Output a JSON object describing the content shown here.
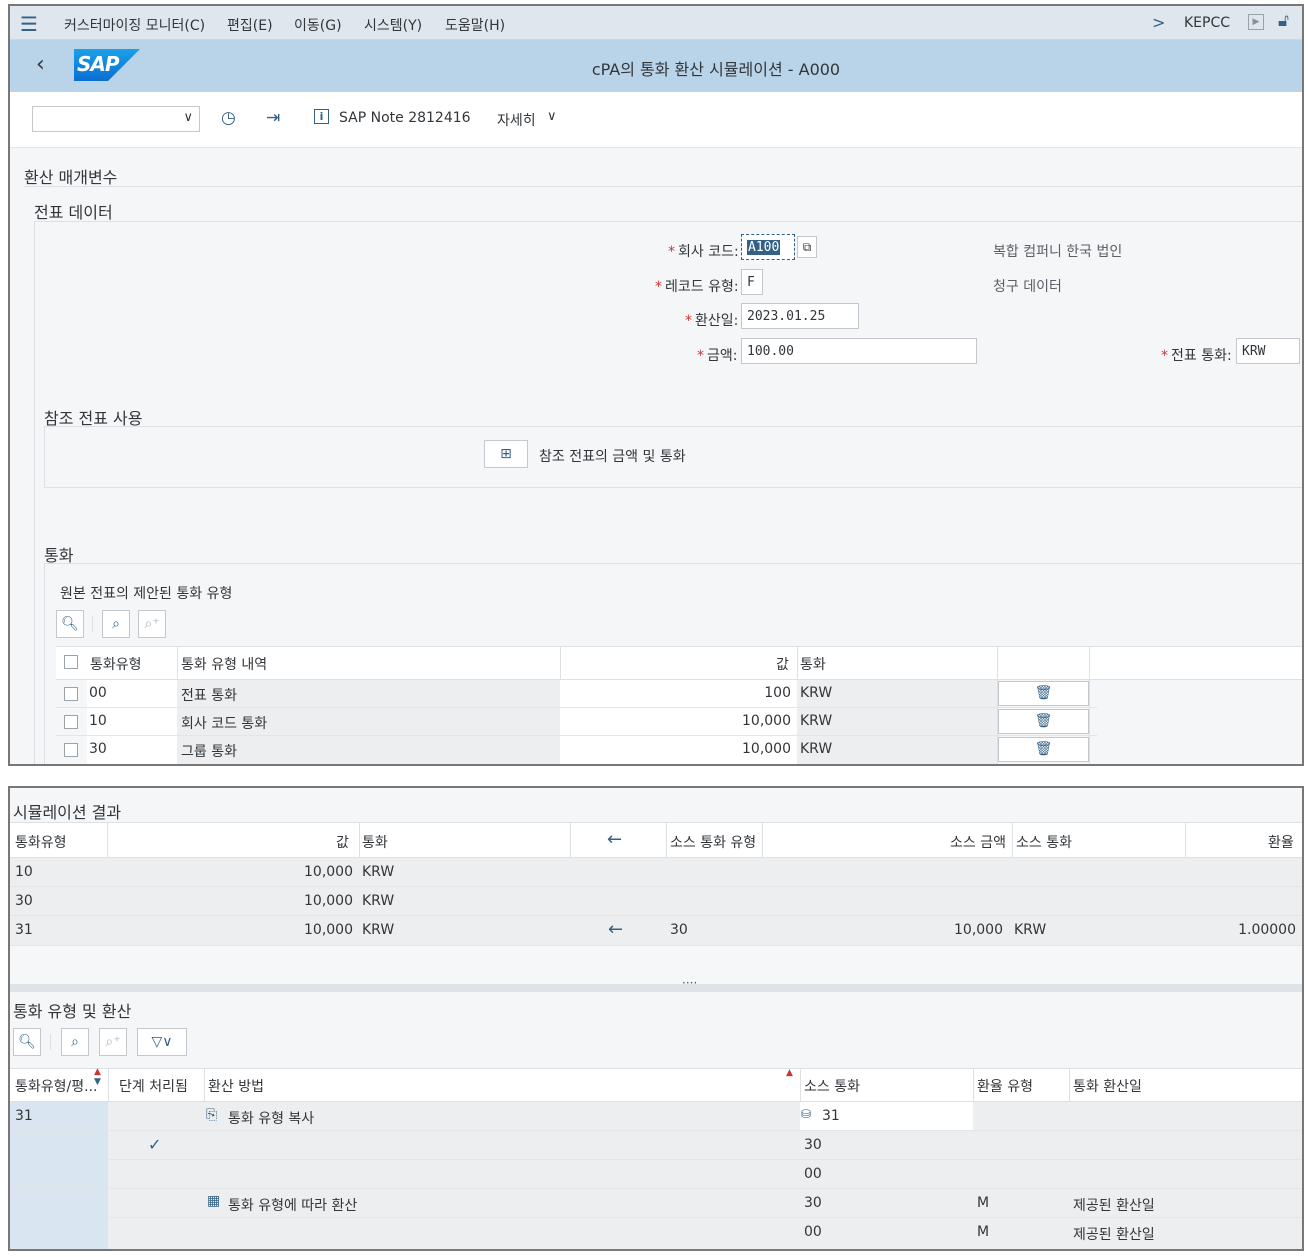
{
  "menu": {
    "items": [
      "커스터마이징 모니터(C)",
      "편집(E)",
      "이동(G)",
      "시스템(Y)",
      "도움말(H)"
    ],
    "system_id": "KEPCC"
  },
  "title": {
    "logo": "SAP",
    "text": "cPA의 통화 환산 시뮬레이션 - A000"
  },
  "toolbar": {
    "dropdown_value": "",
    "note_label": "SAP Note 2812416",
    "more_label": "자세히"
  },
  "params": {
    "section_title": "환산 매개변수",
    "doc_data_title": "전표 데이터",
    "company_code_label": "회사 코드:",
    "company_code_value": "A100",
    "company_code_desc": "복합 컴퍼니 한국 법인",
    "record_type_label": "레코드 유형:",
    "record_type_value": "F",
    "record_type_desc": "청구 데이터",
    "conv_date_label": "환산일:",
    "conv_date_value": "2023.01.25",
    "amount_label": "금액:",
    "amount_value": "100.00",
    "doc_currency_label": "전표 통화:",
    "doc_currency_value": "KRW"
  },
  "reference": {
    "title": "참조 전표 사용",
    "button_label": "참조 전표의 금액 및 통화"
  },
  "currency": {
    "title": "통화",
    "subtitle": "원본 전표의 제안된 통화 유형",
    "columns": [
      "통화유형",
      "통화 유형 내역",
      "값",
      "통화"
    ],
    "rows": [
      {
        "type": "00",
        "desc": "전표 통화",
        "value": "100",
        "currency": "KRW"
      },
      {
        "type": "10",
        "desc": "회사 코드 통화",
        "value": "10,000",
        "currency": "KRW"
      },
      {
        "type": "30",
        "desc": "그룹 통화",
        "value": "10,000",
        "currency": "KRW"
      }
    ]
  },
  "results": {
    "title": "시뮬레이션 결과",
    "columns": [
      "통화유형",
      "값",
      "통화",
      "소스 통화 유형",
      "소스 금액",
      "소스 통화",
      "환율"
    ],
    "rows": [
      {
        "type": "10",
        "value": "10,000",
        "currency": "KRW",
        "arrow": false,
        "src_type": "",
        "src_amount": "",
        "src_currency": "",
        "rate": ""
      },
      {
        "type": "30",
        "value": "10,000",
        "currency": "KRW",
        "arrow": false,
        "src_type": "",
        "src_amount": "",
        "src_currency": "",
        "rate": ""
      },
      {
        "type": "31",
        "value": "10,000",
        "currency": "KRW",
        "arrow": true,
        "src_type": "30",
        "src_amount": "10,000",
        "src_currency": "KRW",
        "rate": "1.00000"
      }
    ]
  },
  "conversion": {
    "title": "통화 유형 및 환산",
    "columns": [
      "통화유형/평...",
      "단계 처리됨",
      "환산 방법",
      "소스 통화",
      "환율 유형",
      "통화 환산일"
    ],
    "rows": [
      {
        "type": "31",
        "done": false,
        "method": "통화 유형 복사",
        "method_icon": "copy-icon",
        "src": "31",
        "src_icon": "currency-type-icon",
        "rate_type": "",
        "date": ""
      },
      {
        "type": "",
        "done": true,
        "method": "",
        "method_icon": "",
        "src": "30",
        "src_icon": "",
        "rate_type": "",
        "date": ""
      },
      {
        "type": "",
        "done": false,
        "method": "",
        "method_icon": "",
        "src": "00",
        "src_icon": "",
        "rate_type": "",
        "date": ""
      },
      {
        "type": "",
        "done": false,
        "method": "통화 유형에 따라 환산",
        "method_icon": "calculator-icon",
        "src": "30",
        "src_icon": "",
        "rate_type": "M",
        "date": "제공된 환산일"
      },
      {
        "type": "",
        "done": false,
        "method": "",
        "method_icon": "",
        "src": "00",
        "src_icon": "",
        "rate_type": "M",
        "date": "제공된 환산일"
      }
    ]
  }
}
